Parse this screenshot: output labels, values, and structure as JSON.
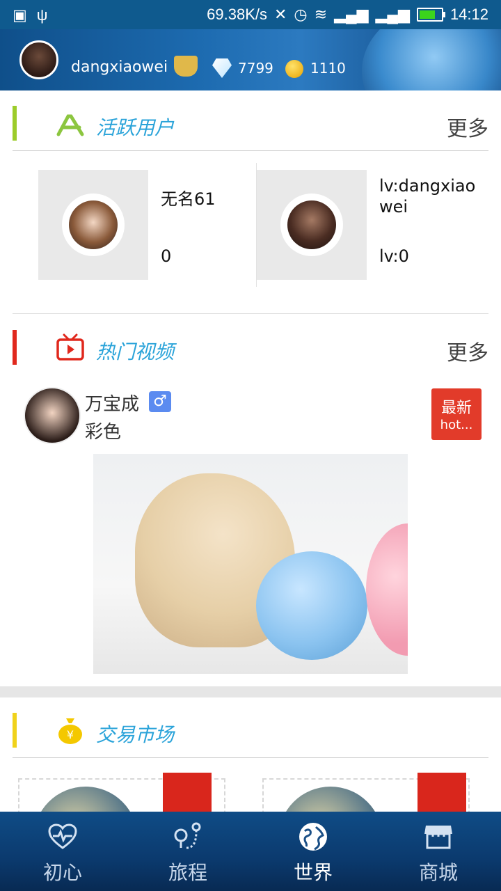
{
  "status_bar": {
    "net_speed": "69.38K/s",
    "time": "14:12",
    "battery_level": 0.75
  },
  "header": {
    "username": "dangxiaowei",
    "gems": "7799",
    "coins": "1110"
  },
  "active_users": {
    "title": "活跃用户",
    "more": "更多",
    "users": [
      {
        "name": "无名61",
        "level": "0"
      },
      {
        "name": "lv:dangxiaowei",
        "level": "lv:0"
      }
    ]
  },
  "hot_videos": {
    "title": "热门视频",
    "more": "更多",
    "author": "万宝成",
    "gender_symbol": "♂",
    "subtitle": "彩色",
    "badge_line1": "最新",
    "badge_line2": "hot..."
  },
  "market": {
    "title": "交易市场"
  },
  "nav": {
    "items": [
      {
        "label": "初心",
        "icon": "heart-pulse-icon"
      },
      {
        "label": "旅程",
        "icon": "route-icon"
      },
      {
        "label": "世界",
        "icon": "globe-icon"
      },
      {
        "label": "商城",
        "icon": "store-icon"
      }
    ],
    "active": "世界"
  },
  "colors": {
    "accent_blue": "#2aa3d9",
    "active_users_bar": "#9ccc2a",
    "hot_video_bar": "#e0281d",
    "market_bar": "#f0d21b"
  }
}
